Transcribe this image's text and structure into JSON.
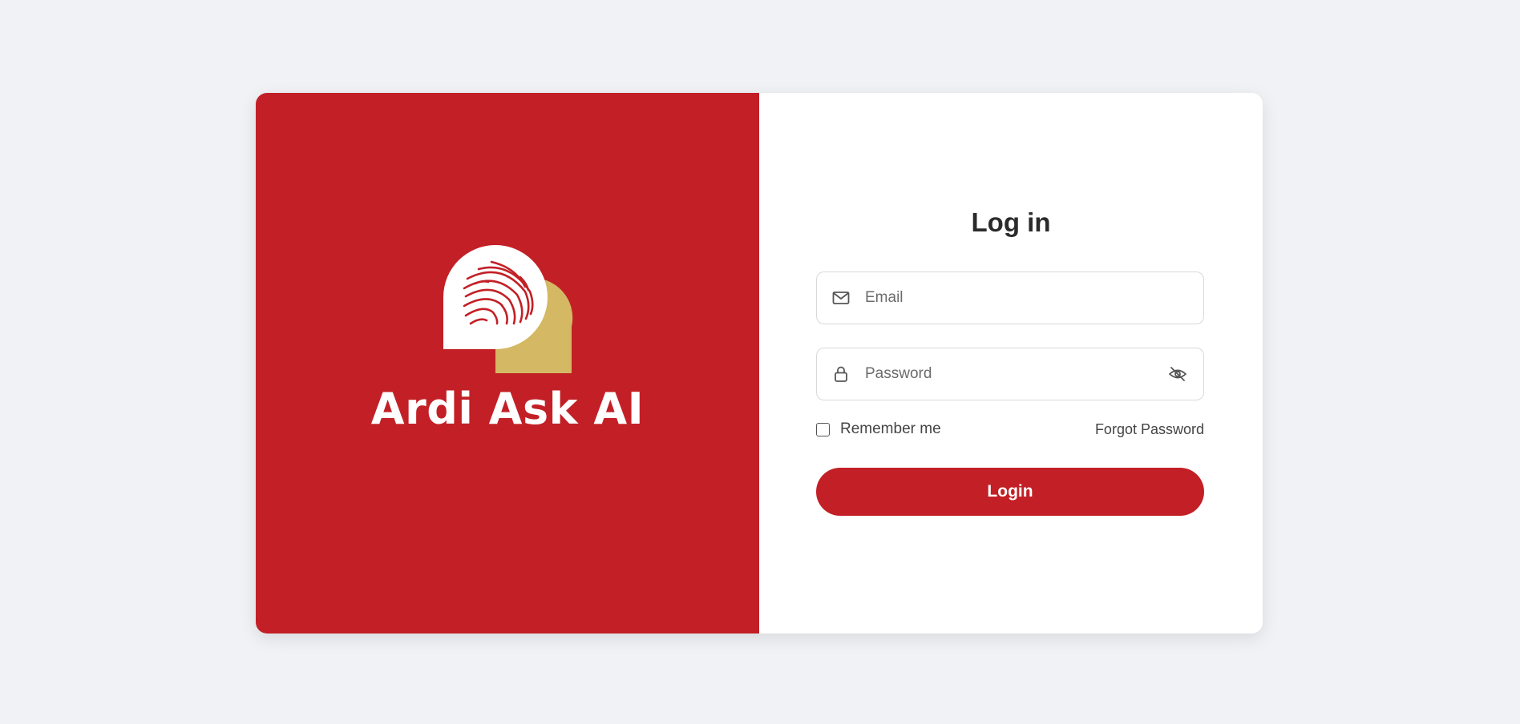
{
  "brand": {
    "name": "Ardi Ask AI",
    "logo_icon": "fingerprint-chat-bubble-icon",
    "colors": {
      "primary": "#c22026",
      "accent": "#d4b863",
      "background": "#f0f2f5"
    }
  },
  "form": {
    "title": "Log in",
    "email": {
      "placeholder": "Email",
      "value": "",
      "icon": "mail-icon"
    },
    "password": {
      "placeholder": "Password",
      "value": "",
      "icon": "lock-icon",
      "toggle_icon": "eye-off-icon"
    },
    "remember_label": "Remember me",
    "remember_checked": false,
    "forgot_label": "Forgot Password",
    "submit_label": "Login"
  }
}
